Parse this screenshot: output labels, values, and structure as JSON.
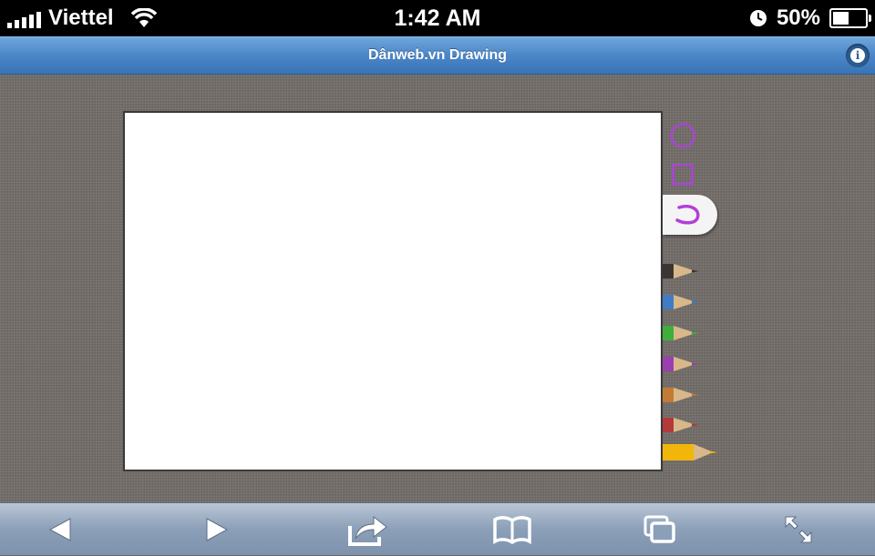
{
  "status_bar": {
    "carrier": "Viettel",
    "time": "1:42 AM",
    "battery_percent": "50%",
    "battery_level": 0.5,
    "signal_bars": 5
  },
  "header": {
    "title": "Dânweb.vn Drawing",
    "info_icon": "info-icon"
  },
  "tools": {
    "shapes": [
      "circle-tool-icon",
      "square-tool-icon",
      "freehand-tool-icon"
    ],
    "selected_shape": "freehand",
    "accent_color": "#a24bc4",
    "pencils": [
      {
        "name": "black",
        "color": "#3a3533"
      },
      {
        "name": "blue",
        "color": "#3f7cc4"
      },
      {
        "name": "green",
        "color": "#3fae3a"
      },
      {
        "name": "purple",
        "color": "#9b3fb0"
      },
      {
        "name": "orange",
        "color": "#c27a35"
      },
      {
        "name": "red",
        "color": "#b23a3a"
      },
      {
        "name": "yellow",
        "color": "#f2b60a"
      }
    ],
    "selected_pencil": "yellow"
  },
  "toolbar": {
    "buttons": [
      "back-icon",
      "forward-icon",
      "share-icon",
      "bookmarks-icon",
      "tabs-icon",
      "fullscreen-icon"
    ]
  }
}
